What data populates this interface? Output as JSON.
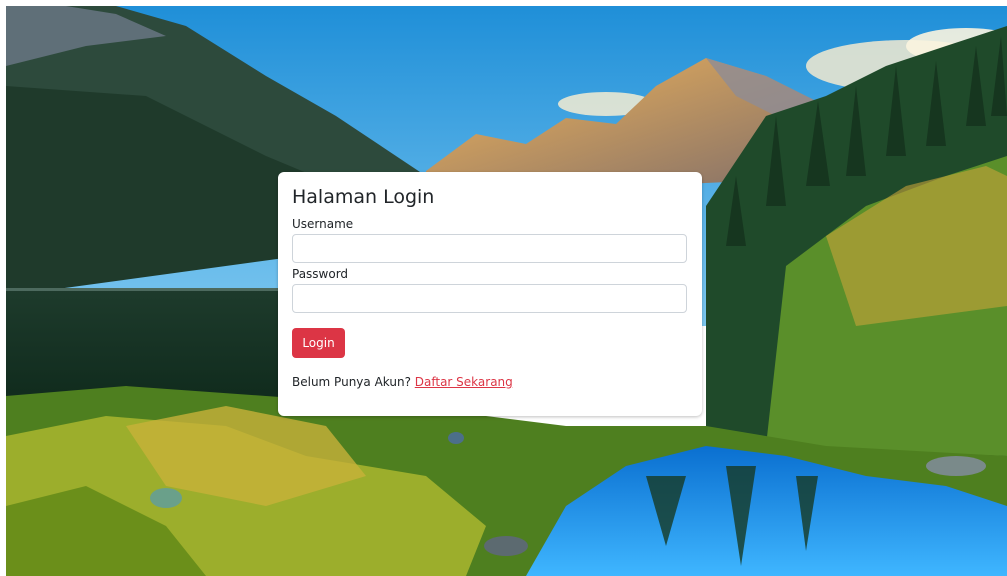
{
  "login_card": {
    "title": "Halaman Login",
    "username_label": "Username",
    "username_value": "",
    "password_label": "Password",
    "password_value": "",
    "login_button": "Login",
    "signup_prompt": "Belum Punya Akun?",
    "signup_link": "Daftar Sekarang"
  },
  "colors": {
    "button": "#dc3545",
    "link": "#dc3545",
    "card": "#ffffff"
  }
}
